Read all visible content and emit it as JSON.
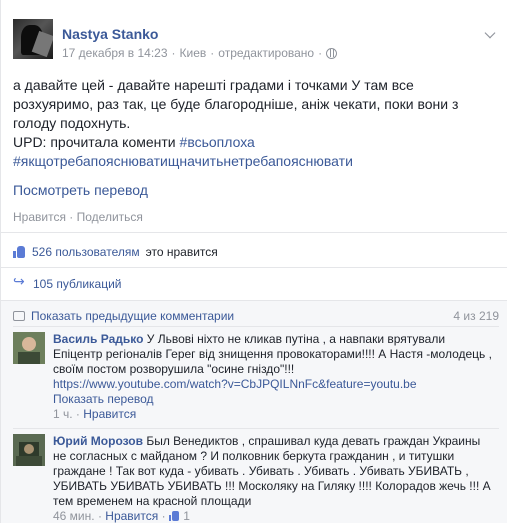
{
  "post": {
    "author": "Nastya Stanko",
    "date": "17 декабря в 14:23",
    "sep1": "·",
    "location": "Киев",
    "sep2": "·",
    "edited": "отредактировано",
    "sep3": "·",
    "text_line1": "а давайте цей - давайте нарешті градами і точками У там все",
    "text_line2": "розхуяримо, раз так, це буде благороднiше, анiж чекати, поки вони з",
    "text_line3": "голоду подохнуть.",
    "upd_prefix": "UPD: прочитала коменти ",
    "hashtag1": "#всьоплоха",
    "hashtag2": "#якщотребапояснюватищначитьнетребапояснювати",
    "translate": "Посмотреть перевод",
    "like_action": "Нравится",
    "action_sep": " · ",
    "share_action": "Поделиться"
  },
  "stats": {
    "likes_link": "526 пользователям",
    "likes_text": "это нравится",
    "shares": "105 публикаций"
  },
  "comments_header": {
    "show_previous": "Показать предыдущие комментарии",
    "count": "4 из 219"
  },
  "comments": [
    {
      "name": "Василь Радько",
      "text": " У Львові ніхто не кликав путіна , а навпаки врятували Епіцентр регіоналів Герег від знищення провокаторами!!!! А Настя -молодець , своїм постом розворушила \"осине гнiздо\"!!!",
      "link": "https://www.youtube.com/watch?v=CbJPQILNnFc&feature=youtu.be",
      "translate": "Показать перевод",
      "time": "1 ч.",
      "dot": " · ",
      "like": "Нравится"
    },
    {
      "name": "Юрий Морозов",
      "text": " Был Венедиктов , спрашивал куда девать граждан Украины не согласных с майданом ? И полковник беркута гражданин , и титушки граждане ! Так вот куда - убивать . Убивать . Убивать . Убивать УБИВАТЬ , УБИВАТЬ УБИВАТЬ УБИВАТЬ !!! Москоляку на Гиляку !!!! Колорадов жечь !!! А тем временем на красной площади",
      "time": "46 мин.",
      "dot": " · ",
      "like": "Нравится",
      "dot2": " · ",
      "like_count": "1"
    }
  ],
  "colors": {
    "link": "#3b5998",
    "muted": "#90949c",
    "text": "#1d2129",
    "comments_bg": "#f6f7f9"
  }
}
